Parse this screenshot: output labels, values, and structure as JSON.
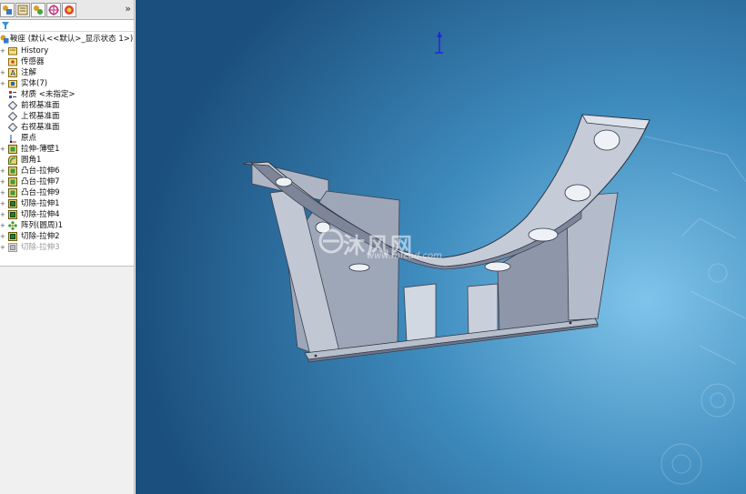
{
  "colors": {
    "viewport_center": "#7fc4ea",
    "viewport_edge": "#1b4f7d",
    "part_face": "#c5ccd8",
    "part_shadow": "#8a93a6",
    "triad": "#1c2bd6"
  },
  "tabs": {
    "icons": [
      "feature-manager-icon",
      "property-manager-icon",
      "configuration-manager-icon",
      "dimxpert-icon",
      "display-manager-icon"
    ],
    "more": "»"
  },
  "tree": {
    "root": {
      "label": "鞍座 (默认<<默认>_显示状态 1>)"
    },
    "items": [
      {
        "label": "History",
        "icon": "history-folder-icon",
        "expandable": true
      },
      {
        "label": "传感器",
        "icon": "sensor-icon",
        "expandable": false
      },
      {
        "label": "注解",
        "icon": "annotation-icon",
        "expandable": true
      },
      {
        "label": "实体(7)",
        "icon": "solid-bodies-icon",
        "expandable": true
      },
      {
        "label": "材质 <未指定>",
        "icon": "material-icon",
        "expandable": false
      },
      {
        "label": "前视基准面",
        "icon": "plane-icon",
        "expandable": false
      },
      {
        "label": "上视基准面",
        "icon": "plane-icon",
        "expandable": false
      },
      {
        "label": "右视基准面",
        "icon": "plane-icon",
        "expandable": false
      },
      {
        "label": "原点",
        "icon": "origin-icon",
        "expandable": false
      },
      {
        "label": "拉伸-薄壁1",
        "icon": "extrude-icon",
        "expandable": true
      },
      {
        "label": "圆角1",
        "icon": "fillet-icon",
        "expandable": false
      },
      {
        "label": "凸台-拉伸6",
        "icon": "extrude-icon",
        "expandable": true
      },
      {
        "label": "凸台-拉伸7",
        "icon": "extrude-icon",
        "expandable": true
      },
      {
        "label": "凸台-拉伸9",
        "icon": "extrude-icon",
        "expandable": true
      },
      {
        "label": "切除-拉伸1",
        "icon": "cut-extrude-icon",
        "expandable": true
      },
      {
        "label": "切除-拉伸4",
        "icon": "cut-extrude-icon",
        "expandable": true
      },
      {
        "label": "阵列(圆周)1",
        "icon": "circular-pattern-icon",
        "expandable": true
      },
      {
        "label": "切除-拉伸2",
        "icon": "cut-extrude-icon",
        "expandable": true
      },
      {
        "label": "切除-拉伸3",
        "icon": "cut-extrude-icon",
        "expandable": true,
        "suppressed": true
      }
    ]
  },
  "watermark": {
    "text": "沐风网",
    "url": "www.mfcad.com"
  }
}
